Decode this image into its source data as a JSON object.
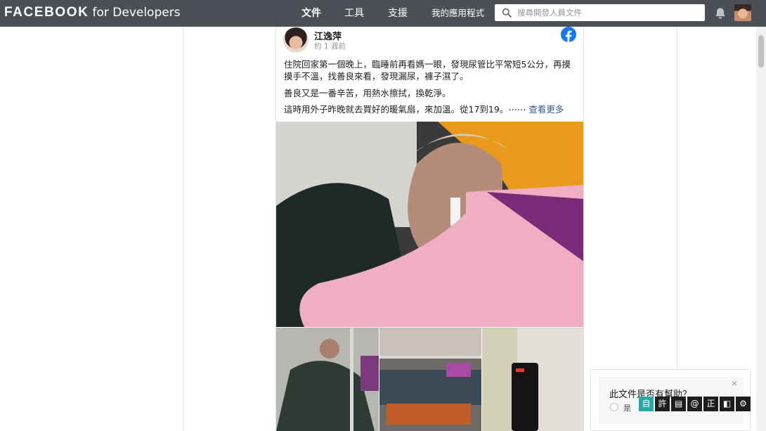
{
  "header": {
    "brand_main": "FACEBOOK",
    "brand_sub": "for Developers",
    "nav": [
      {
        "label": "文件",
        "active": true
      },
      {
        "label": "工具",
        "active": false
      },
      {
        "label": "支援",
        "active": false
      },
      {
        "label": "我的應用程式",
        "active": false
      }
    ],
    "search_placeholder": "搜尋開發人員文件",
    "icons": {
      "search": "search-icon",
      "notifications": "bell-icon"
    }
  },
  "post": {
    "author": "江逸萍",
    "time_ago": "約 1 週前",
    "paragraphs": [
      "住院回家第一個晚上，臨睡前再看媽一眼，發現尿管比平常短5公分，再摸摸手不溫，找善良來看，發現漏尿，褲子濕了。",
      "善良又是一番辛苦，用熱水擦拭，換乾淨。",
      "這時用外子昨晚就去買好的暖氣扇，來加溫。從17到19。⋯⋯"
    ],
    "see_more": "查看更多",
    "icons": {
      "platform": "facebook-logo-icon"
    }
  },
  "feedback": {
    "question": "此文件是否有幫助？",
    "yes_label": "是",
    "close_symbol": "×"
  },
  "tools": [
    "自",
    "許",
    "▤",
    "@",
    "正",
    "◧",
    "⚙"
  ],
  "colors": {
    "header_bg": "#4b4f56",
    "link": "#385898",
    "accent_tool": "#2aa7a7"
  }
}
